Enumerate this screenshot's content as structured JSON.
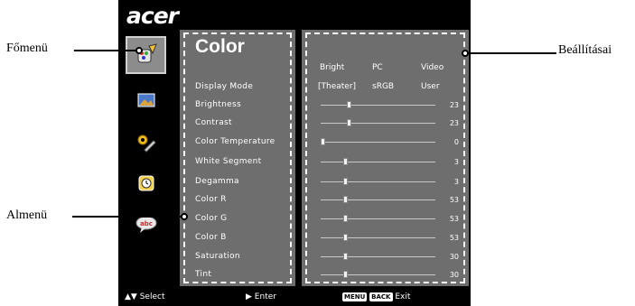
{
  "brand": "acer",
  "callouts": {
    "main_menu": "Főmenü",
    "submenu": "Almenü",
    "settings": "Beállításai"
  },
  "menu": {
    "title": "Color",
    "items": [
      {
        "label": "Display Mode"
      },
      {
        "label": "Brightness",
        "value": "23",
        "level": 0.23
      },
      {
        "label": "Contrast",
        "value": "23",
        "level": 0.23
      },
      {
        "label": "Color Temperature",
        "value": "0",
        "level": 0.0
      },
      {
        "label": "White Segment",
        "value": "3",
        "level": 0.2
      },
      {
        "label": "Degamma",
        "value": "3",
        "level": 0.2
      },
      {
        "label": "Color R",
        "value": "53",
        "level": 0.2
      },
      {
        "label": "Color G",
        "value": "53",
        "level": 0.2
      },
      {
        "label": "Color B",
        "value": "53",
        "level": 0.2
      },
      {
        "label": "Saturation",
        "value": "30",
        "level": 0.2
      },
      {
        "label": "Tint",
        "value": "30",
        "level": 0.2
      }
    ]
  },
  "mode_headers": [
    "Bright",
    "PC",
    "Video"
  ],
  "mode_options": [
    "[Theater]",
    "sRGB",
    "User"
  ],
  "icons": [
    "color-palette-icon",
    "picture-icon",
    "settings-tools-icon",
    "clock-icon",
    "language-bubble-icon"
  ],
  "footer": {
    "select": "Select",
    "enter": "Enter",
    "menu_key": "MENU",
    "back_key": "BACK",
    "exit": "Exit"
  },
  "colors": {
    "osd_bg": "#000000",
    "panel": "#6e6e6e",
    "accent": "#ffffff"
  }
}
